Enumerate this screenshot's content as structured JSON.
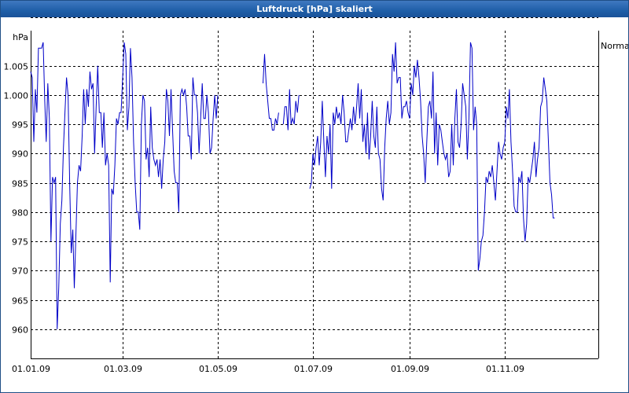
{
  "window": {
    "title": "Luftdruck [hPa] skaliert"
  },
  "chart_data": {
    "type": "line",
    "title": "Luftdruck [hPa] skaliert",
    "ylabel": "hPa",
    "ylim": [
      955,
      1011
    ],
    "xlim": [
      "2009-01-01",
      "2009-12-31"
    ],
    "grid": true,
    "y_ticks": [
      960,
      965,
      970,
      975,
      980,
      985,
      990,
      995,
      1000,
      1005
    ],
    "y_tick_labels": [
      "960",
      "965",
      "970",
      "975",
      "980",
      "985",
      "990",
      "995",
      "1.000",
      "1.005"
    ],
    "x_ticks": [
      "2009-01-01",
      "2009-03-01",
      "2009-05-01",
      "2009-07-01",
      "2009-09-01",
      "2009-11-01"
    ],
    "x_tick_labels": [
      "01.01.09",
      "01.03.09",
      "01.05.09",
      "01.07.09",
      "01.09.09",
      "01.11.09"
    ],
    "reference_line": {
      "label": "Normal",
      "value": 1013.25
    },
    "line_color": "#0000c8",
    "series": [
      {
        "name": "",
        "segments": [
          {
            "x": [
              "2009-01-01",
              "2009-01-02",
              "2009-01-03",
              "2009-01-04",
              "2009-01-05",
              "2009-01-06",
              "2009-01-07",
              "2009-01-08",
              "2009-01-09",
              "2009-01-10",
              "2009-01-11",
              "2009-01-12",
              "2009-01-13",
              "2009-01-14",
              "2009-01-15",
              "2009-01-16",
              "2009-01-17",
              "2009-01-18",
              "2009-01-19",
              "2009-01-20",
              "2009-01-21",
              "2009-01-22",
              "2009-01-23",
              "2009-01-24",
              "2009-01-25",
              "2009-01-26",
              "2009-01-27",
              "2009-01-28",
              "2009-01-29",
              "2009-01-30",
              "2009-01-31",
              "2009-02-01",
              "2009-02-02",
              "2009-02-03",
              "2009-02-04",
              "2009-02-05",
              "2009-02-06",
              "2009-02-07",
              "2009-02-08",
              "2009-02-09",
              "2009-02-10",
              "2009-02-11",
              "2009-02-12",
              "2009-02-13",
              "2009-02-14",
              "2009-02-15",
              "2009-02-16",
              "2009-02-17",
              "2009-02-18",
              "2009-02-19",
              "2009-02-20",
              "2009-02-21",
              "2009-02-22",
              "2009-02-23",
              "2009-02-24",
              "2009-02-25",
              "2009-02-26",
              "2009-02-27",
              "2009-02-28",
              "2009-03-01",
              "2009-03-02",
              "2009-03-03",
              "2009-03-04",
              "2009-03-05",
              "2009-03-06",
              "2009-03-07",
              "2009-03-08",
              "2009-03-09",
              "2009-03-10",
              "2009-03-11",
              "2009-03-12",
              "2009-03-13",
              "2009-03-14",
              "2009-03-15",
              "2009-03-16",
              "2009-03-17",
              "2009-03-18",
              "2009-03-19",
              "2009-03-20",
              "2009-03-21",
              "2009-03-22",
              "2009-03-23",
              "2009-03-24",
              "2009-03-25",
              "2009-03-26",
              "2009-03-27",
              "2009-03-28",
              "2009-03-29",
              "2009-03-30",
              "2009-03-31",
              "2009-04-01",
              "2009-04-02",
              "2009-04-03",
              "2009-04-04",
              "2009-04-05",
              "2009-04-06",
              "2009-04-07",
              "2009-04-08",
              "2009-04-09",
              "2009-04-10",
              "2009-04-11",
              "2009-04-12",
              "2009-04-13",
              "2009-04-14",
              "2009-04-15",
              "2009-04-16",
              "2009-04-17",
              "2009-04-18",
              "2009-04-19",
              "2009-04-20",
              "2009-04-21",
              "2009-04-22",
              "2009-04-23",
              "2009-04-24",
              "2009-04-25",
              "2009-04-26",
              "2009-04-27",
              "2009-04-28",
              "2009-04-29",
              "2009-04-30",
              "2009-05-01",
              "2009-05-02",
              "2009-05-03",
              "2009-05-04",
              "2009-05-05",
              "2009-05-06",
              "2009-05-07",
              "2009-05-08",
              "2009-05-09",
              "2009-05-10",
              "2009-05-11",
              "2009-05-12",
              "2009-05-13",
              "2009-05-14",
              "2009-05-15",
              "2009-05-16",
              "2009-05-17",
              "2009-05-18",
              "2009-05-19",
              "2009-05-20",
              "2009-05-21",
              "2009-05-22",
              "2009-05-23"
            ],
            "y": [
              1004,
              1003,
              992,
              1001,
              997,
              1008,
              1008,
              1008,
              1009,
              999,
              992,
              1002,
              996,
              975,
              986,
              985,
              986,
              960,
              967,
              978,
              982,
              991,
              997,
              1003,
              1000,
              985,
              973,
              977,
              967,
              976,
              985,
              988,
              987,
              993,
              1001,
              995,
              1001,
              998,
              1004,
              1001,
              1002,
              990,
              998,
              1005,
              997,
              997,
              991,
              997,
              988,
              990,
              988,
              968,
              984,
              983,
              988,
              996,
              995,
              997,
              997,
              1003,
              1009,
              1007,
              994,
              998,
              1008,
              1003,
              992,
              985,
              980,
              980,
              977,
              995,
              1000,
              999,
              989,
              991,
              986,
              998,
              991,
              989,
              988,
              989,
              986,
              989,
              984,
              989,
              992,
              1001,
              999,
              993,
              1001,
              994,
              987,
              985,
              985,
              980,
              1000,
              1001,
              1000,
              1001,
              998,
              993,
              993,
              989,
              1003,
              1000,
              1000,
              997,
              990,
              996,
              1002,
              996,
              996,
              1000,
              997,
              990,
              991,
              996,
              1000,
              996,
              1000
            ]
          },
          {
            "x": [
              "2009-05-30",
              "2009-05-31",
              "2009-06-01",
              "2009-06-02",
              "2009-06-03",
              "2009-06-04",
              "2009-06-05",
              "2009-06-06",
              "2009-06-07",
              "2009-06-08",
              "2009-06-09"
            ],
            "y": [
              1002,
              1007,
              1002,
              999,
              996,
              996,
              994,
              994,
              996,
              995,
              997
            ]
          },
          {
            "x": [
              "2009-06-12",
              "2009-06-13",
              "2009-06-14",
              "2009-06-15",
              "2009-06-16",
              "2009-06-17",
              "2009-06-18",
              "2009-06-19",
              "2009-06-20",
              "2009-06-21",
              "2009-06-22"
            ],
            "y": [
              995,
              998,
              998,
              994,
              1001,
              995,
              996,
              995,
              999,
              997,
              1000
            ]
          },
          {
            "x": [
              "2009-06-29",
              "2009-06-30",
              "2009-07-01",
              "2009-07-02",
              "2009-07-03",
              "2009-07-04",
              "2009-07-05",
              "2009-07-06",
              "2009-07-07",
              "2009-07-08",
              "2009-07-09",
              "2009-07-10",
              "2009-07-11",
              "2009-07-12",
              "2009-07-13",
              "2009-07-14",
              "2009-07-15",
              "2009-07-16",
              "2009-07-17",
              "2009-07-18",
              "2009-07-19",
              "2009-07-20",
              "2009-07-21",
              "2009-07-22",
              "2009-07-23",
              "2009-07-24",
              "2009-07-25",
              "2009-07-26",
              "2009-07-27",
              "2009-07-28",
              "2009-07-29",
              "2009-07-30",
              "2009-07-31",
              "2009-08-01",
              "2009-08-02",
              "2009-08-03",
              "2009-08-04",
              "2009-08-05",
              "2009-08-06",
              "2009-08-07",
              "2009-08-08",
              "2009-08-09",
              "2009-08-10",
              "2009-08-11",
              "2009-08-12",
              "2009-08-13",
              "2009-08-14",
              "2009-08-15",
              "2009-08-16",
              "2009-08-17",
              "2009-08-18",
              "2009-08-19",
              "2009-08-20",
              "2009-08-21",
              "2009-08-22",
              "2009-08-23",
              "2009-08-24",
              "2009-08-25",
              "2009-08-26",
              "2009-08-27",
              "2009-08-28",
              "2009-08-29",
              "2009-08-30",
              "2009-08-31",
              "2009-09-01",
              "2009-09-02",
              "2009-09-03",
              "2009-09-04",
              "2009-09-05",
              "2009-09-06",
              "2009-09-07",
              "2009-09-08",
              "2009-09-09",
              "2009-09-10",
              "2009-09-11",
              "2009-09-12",
              "2009-09-13",
              "2009-09-14",
              "2009-09-15",
              "2009-09-16",
              "2009-09-17",
              "2009-09-18",
              "2009-09-19",
              "2009-09-20",
              "2009-09-21",
              "2009-09-22",
              "2009-09-23",
              "2009-09-24",
              "2009-09-25",
              "2009-09-26",
              "2009-09-27",
              "2009-09-28",
              "2009-09-29",
              "2009-09-30",
              "2009-10-01",
              "2009-10-02",
              "2009-10-03",
              "2009-10-04",
              "2009-10-05",
              "2009-10-06",
              "2009-10-07",
              "2009-10-08",
              "2009-10-09",
              "2009-10-10",
              "2009-10-11",
              "2009-10-12",
              "2009-10-13",
              "2009-10-14",
              "2009-10-15",
              "2009-10-16",
              "2009-10-17",
              "2009-10-18",
              "2009-10-19",
              "2009-10-20",
              "2009-10-21",
              "2009-10-22",
              "2009-10-23",
              "2009-10-24",
              "2009-10-25",
              "2009-10-26",
              "2009-10-27",
              "2009-10-28",
              "2009-10-29",
              "2009-10-30",
              "2009-10-31",
              "2009-11-01",
              "2009-11-02",
              "2009-11-03",
              "2009-11-04",
              "2009-11-05",
              "2009-11-06",
              "2009-11-07",
              "2009-11-08",
              "2009-11-09",
              "2009-11-10",
              "2009-11-11",
              "2009-11-12",
              "2009-11-13",
              "2009-11-14",
              "2009-11-15",
              "2009-11-16",
              "2009-11-17",
              "2009-11-18",
              "2009-11-19",
              "2009-11-20",
              "2009-11-21",
              "2009-11-22",
              "2009-11-23",
              "2009-11-24",
              "2009-11-25",
              "2009-11-26",
              "2009-11-27",
              "2009-11-28",
              "2009-11-29",
              "2009-11-30",
              "2009-12-01",
              "2009-12-02",
              "2009-12-03",
              "2009-12-04",
              "2009-12-05",
              "2009-12-06",
              "2009-12-07",
              "2009-12-08",
              "2009-12-09",
              "2009-12-10",
              "2009-12-11",
              "2009-12-12",
              "2009-12-13",
              "2009-12-14",
              "2009-12-15",
              "2009-12-16",
              "2009-12-17",
              "2009-12-18",
              "2009-12-19",
              "2009-12-20",
              "2009-12-21",
              "2009-12-22",
              "2009-12-23",
              "2009-12-24",
              "2009-12-25",
              "2009-12-26"
            ],
            "y": [
              984,
              985,
              990,
              988,
              991,
              993,
              988,
              992,
              999,
              992,
              986,
              993,
              990,
              995,
              984,
              997,
              995,
              998,
              996,
              997,
              995,
              1000,
              997,
              992,
              992,
              994,
              996,
              994,
              998,
              995,
              998,
              1002,
              996,
              1001,
              992,
              995,
              990,
              997,
              989,
              993,
              999,
              993,
              991,
              998,
              990,
              989,
              984,
              982,
              991,
              996,
              999,
              995,
              997,
              1007,
              1004,
              1009,
              1002,
              1003,
              1003,
              996,
              998,
              998,
              999,
              997,
              996,
              1002,
              1000,
              1005,
              1003,
              1006,
              1003,
              999,
              993,
              990,
              985,
              992,
              998,
              999,
              996,
              1004,
              990,
              997,
              988,
              995,
              994,
              992,
              990,
              989,
              990,
              986,
              987,
              995,
              988,
              996,
              1001,
              992,
              991,
              995,
              1002,
              1000,
              998,
              989,
              996,
              1009,
              1008,
              994,
              998,
              995,
              970,
              972,
              975,
              976,
              980,
              986,
              985,
              987,
              986,
              988,
              985,
              982,
              987,
              992,
              990,
              989,
              991,
              992,
              998,
              996,
              1001,
              992,
              987,
              981,
              980,
              980,
              986,
              985,
              987,
              979,
              975,
              978,
              986,
              985,
              987,
              989,
              992,
              986,
              989,
              991,
              998,
              999,
              1003,
              1001,
              999,
              992,
              985,
              983,
              979,
              979
            ]
          }
        ]
      }
    ]
  }
}
